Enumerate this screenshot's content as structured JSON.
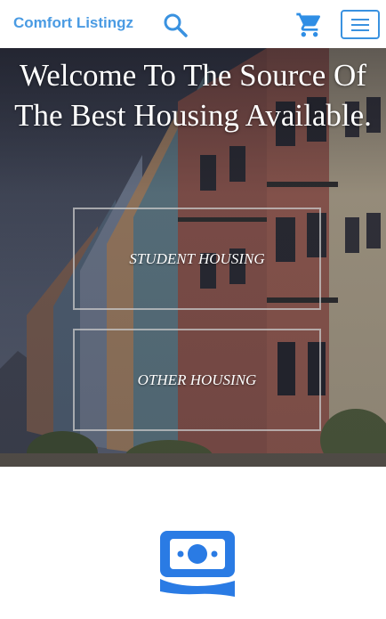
{
  "navbar": {
    "brand": "Comfort Listingz",
    "icons": [
      "search-icon",
      "cart-icon",
      "hamburger-menu-icon"
    ],
    "accent_color": "#4a9be3"
  },
  "hero": {
    "title": "Welcome To The Source Of The Best Housing Available.",
    "buttons": [
      {
        "label": "STUDENT HOUSING"
      },
      {
        "label": "OTHER HOUSING"
      }
    ]
  },
  "feature": {
    "icon": "money-icon",
    "icon_color": "#2a7be4"
  }
}
